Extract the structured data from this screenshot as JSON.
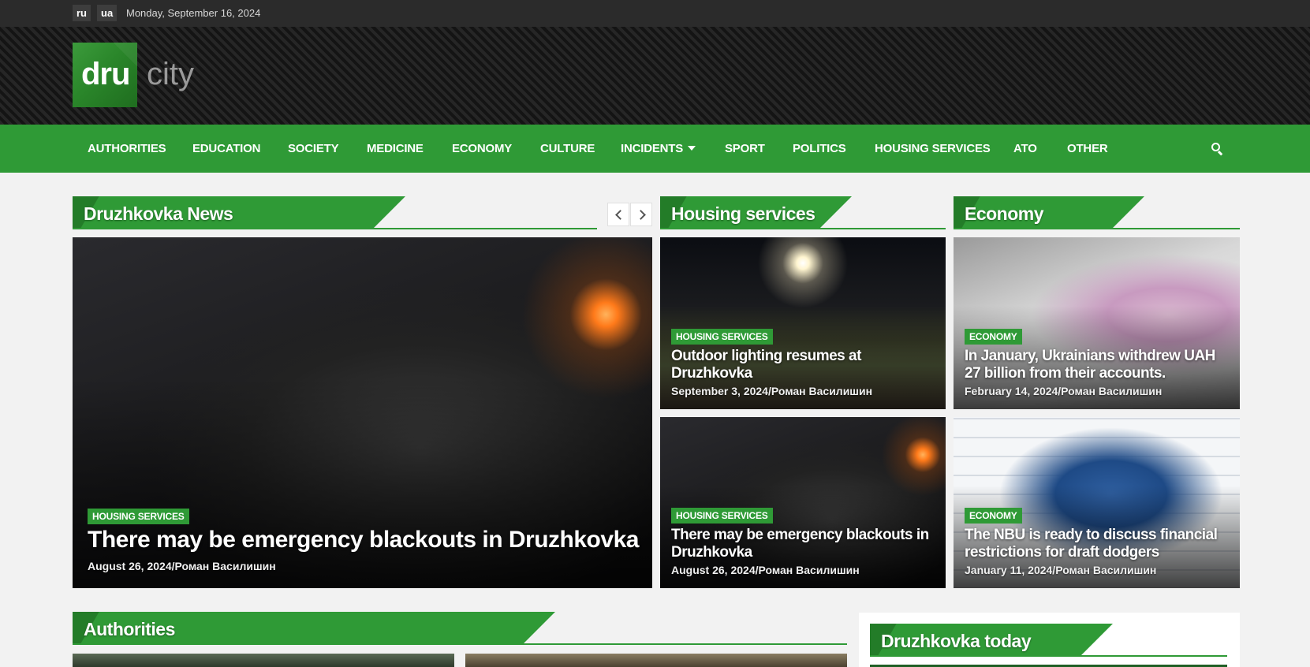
{
  "topbar": {
    "languages": [
      "ru",
      "ua"
    ],
    "date": "Monday, September 16, 2024"
  },
  "logo": {
    "part1": "dru",
    "part2": "city"
  },
  "nav": {
    "items": [
      "AUTHORITIES",
      "EDUCATION",
      "SOCIETY",
      "MEDICINE",
      "ECONOMY",
      "CULTURE",
      "INCIDENTS",
      "SPORT",
      "POLITICS",
      "HOUSING SERVICES",
      "ATO",
      "OTHER"
    ],
    "search_icon": "search-icon"
  },
  "sections": {
    "news": {
      "title": "Druzhkovka News"
    },
    "housing": {
      "title": "Housing services"
    },
    "economy": {
      "title": "Economy"
    },
    "authorities": {
      "title": "Authorities"
    },
    "today": {
      "title": "Druzhkovka today"
    }
  },
  "featured": {
    "category": "HOUSING SERVICES",
    "title": "There may be emergency blackouts in Druzhkovka",
    "meta": "August 26, 2024/Роман Василишин"
  },
  "housing_posts": [
    {
      "category": "HOUSING SERVICES",
      "title": "Outdoor lighting resumes at Druzhkovka",
      "meta": "September 3, 2024/Роман Василишин"
    },
    {
      "category": "HOUSING SERVICES",
      "title": "There may be emergency blackouts in Druzhkovka",
      "meta": "August 26, 2024/Роман Василишин"
    }
  ],
  "economy_posts": [
    {
      "category": "ECONOMY",
      "title": "In January, Ukrainians withdrew UAH 27 billion from their accounts.",
      "meta": "February 14, 2024/Роман Василишин"
    },
    {
      "category": "ECONOMY",
      "title": "The NBU is ready to discuss financial restrictions for draft dodgers",
      "meta": "January 11, 2024/Роман Василишин"
    }
  ],
  "colors": {
    "accent": "#2f9a36",
    "topbar": "#2b2b2b",
    "background": "#f2f2f2"
  }
}
